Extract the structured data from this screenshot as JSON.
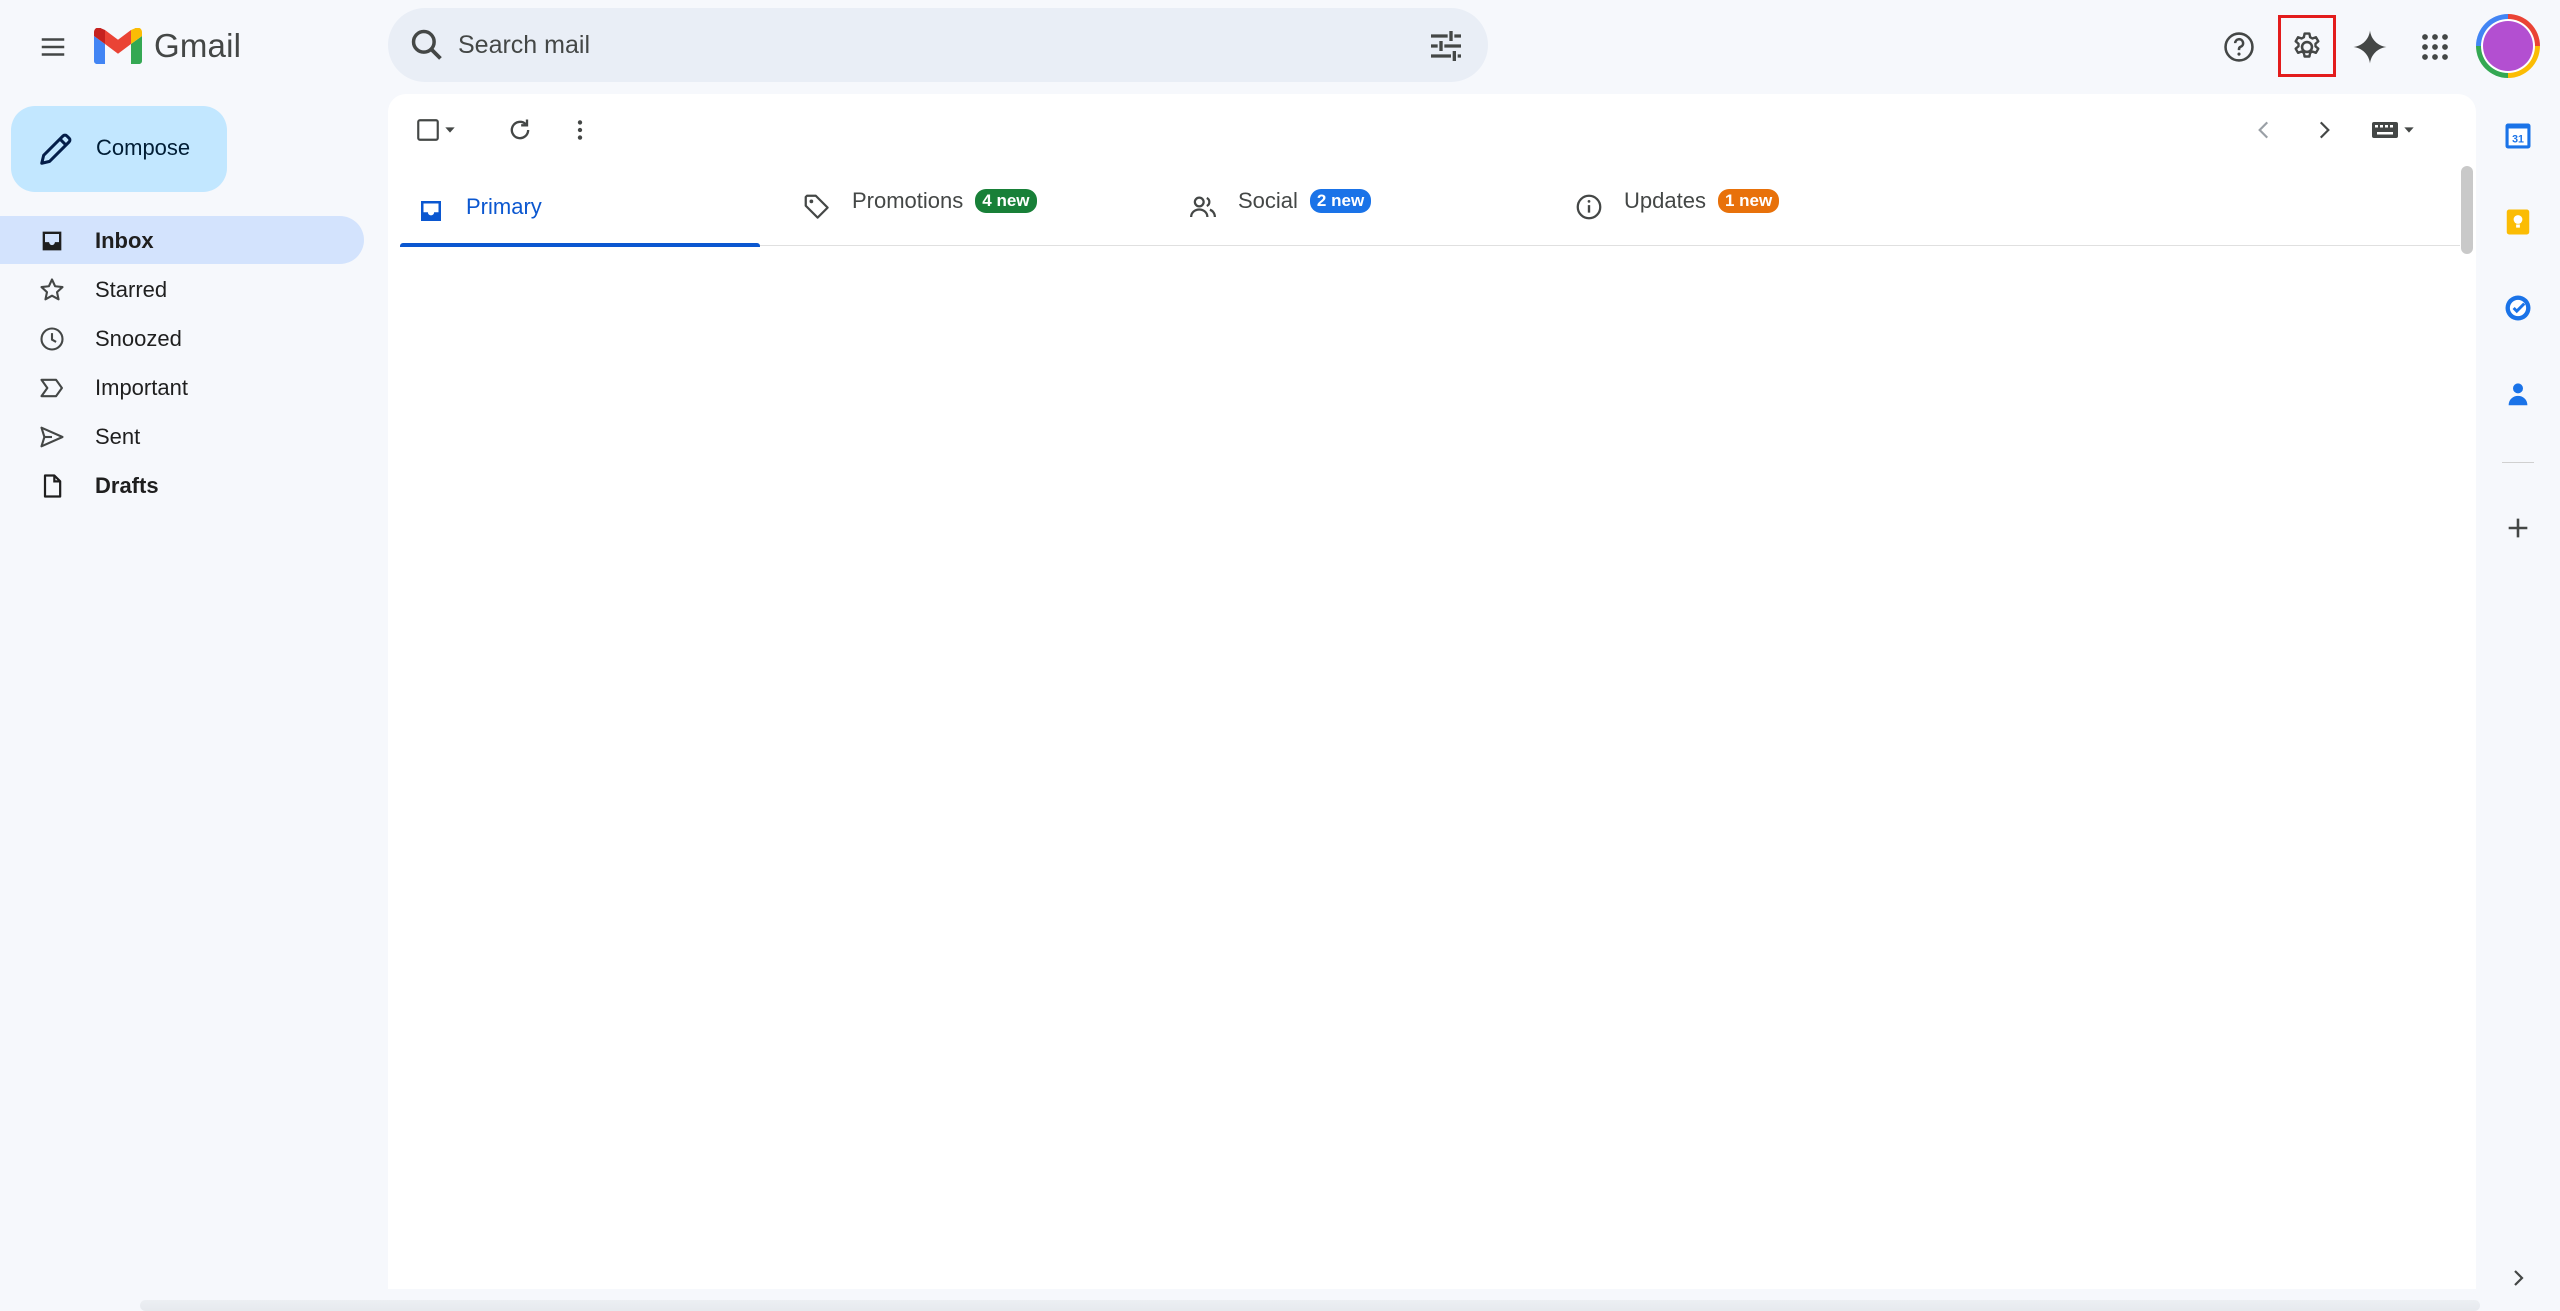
{
  "app": {
    "logo_text": "Gmail"
  },
  "search": {
    "placeholder": "Search mail",
    "value": ""
  },
  "compose": {
    "label": "Compose"
  },
  "nav": {
    "items": [
      {
        "label": "Inbox",
        "icon": "inbox-icon",
        "active": true
      },
      {
        "label": "Starred",
        "icon": "star-icon"
      },
      {
        "label": "Snoozed",
        "icon": "clock-icon"
      },
      {
        "label": "Important",
        "icon": "important-icon"
      },
      {
        "label": "Sent",
        "icon": "send-icon"
      },
      {
        "label": "Drafts",
        "icon": "draft-icon",
        "bold": true
      }
    ]
  },
  "tabs": [
    {
      "label": "Primary",
      "icon": "inbox-icon",
      "active": true
    },
    {
      "label": "Promotions",
      "icon": "tag-icon",
      "badge": "4 new",
      "badge_color": "#188038"
    },
    {
      "label": "Social",
      "icon": "people-icon",
      "badge": "2 new",
      "badge_color": "#1a73e8"
    },
    {
      "label": "Updates",
      "icon": "info-icon",
      "badge": "1 new",
      "badge_color": "#e8710a"
    }
  ],
  "colors": {
    "accent": "#0b57d0",
    "compose_bg": "#c2e7ff",
    "active_nav_bg": "#d3e3fd",
    "highlight_box": "#e31c1c"
  }
}
